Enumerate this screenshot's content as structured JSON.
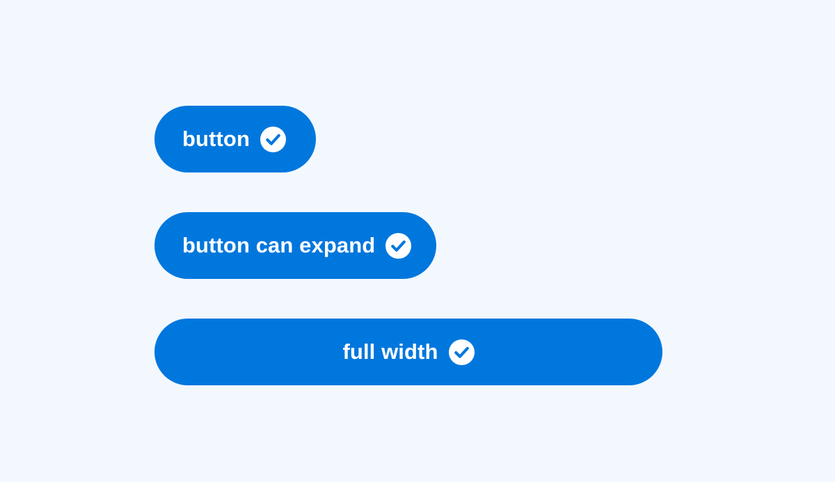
{
  "theme": {
    "background": "#f2f8fe",
    "accent": "#0077dd",
    "text": "#ffffff"
  },
  "buttons": [
    {
      "label": "button",
      "icon": "check-circle-icon"
    },
    {
      "label": "button can expand",
      "icon": "check-circle-icon"
    },
    {
      "label": "full width",
      "icon": "check-circle-icon"
    }
  ]
}
